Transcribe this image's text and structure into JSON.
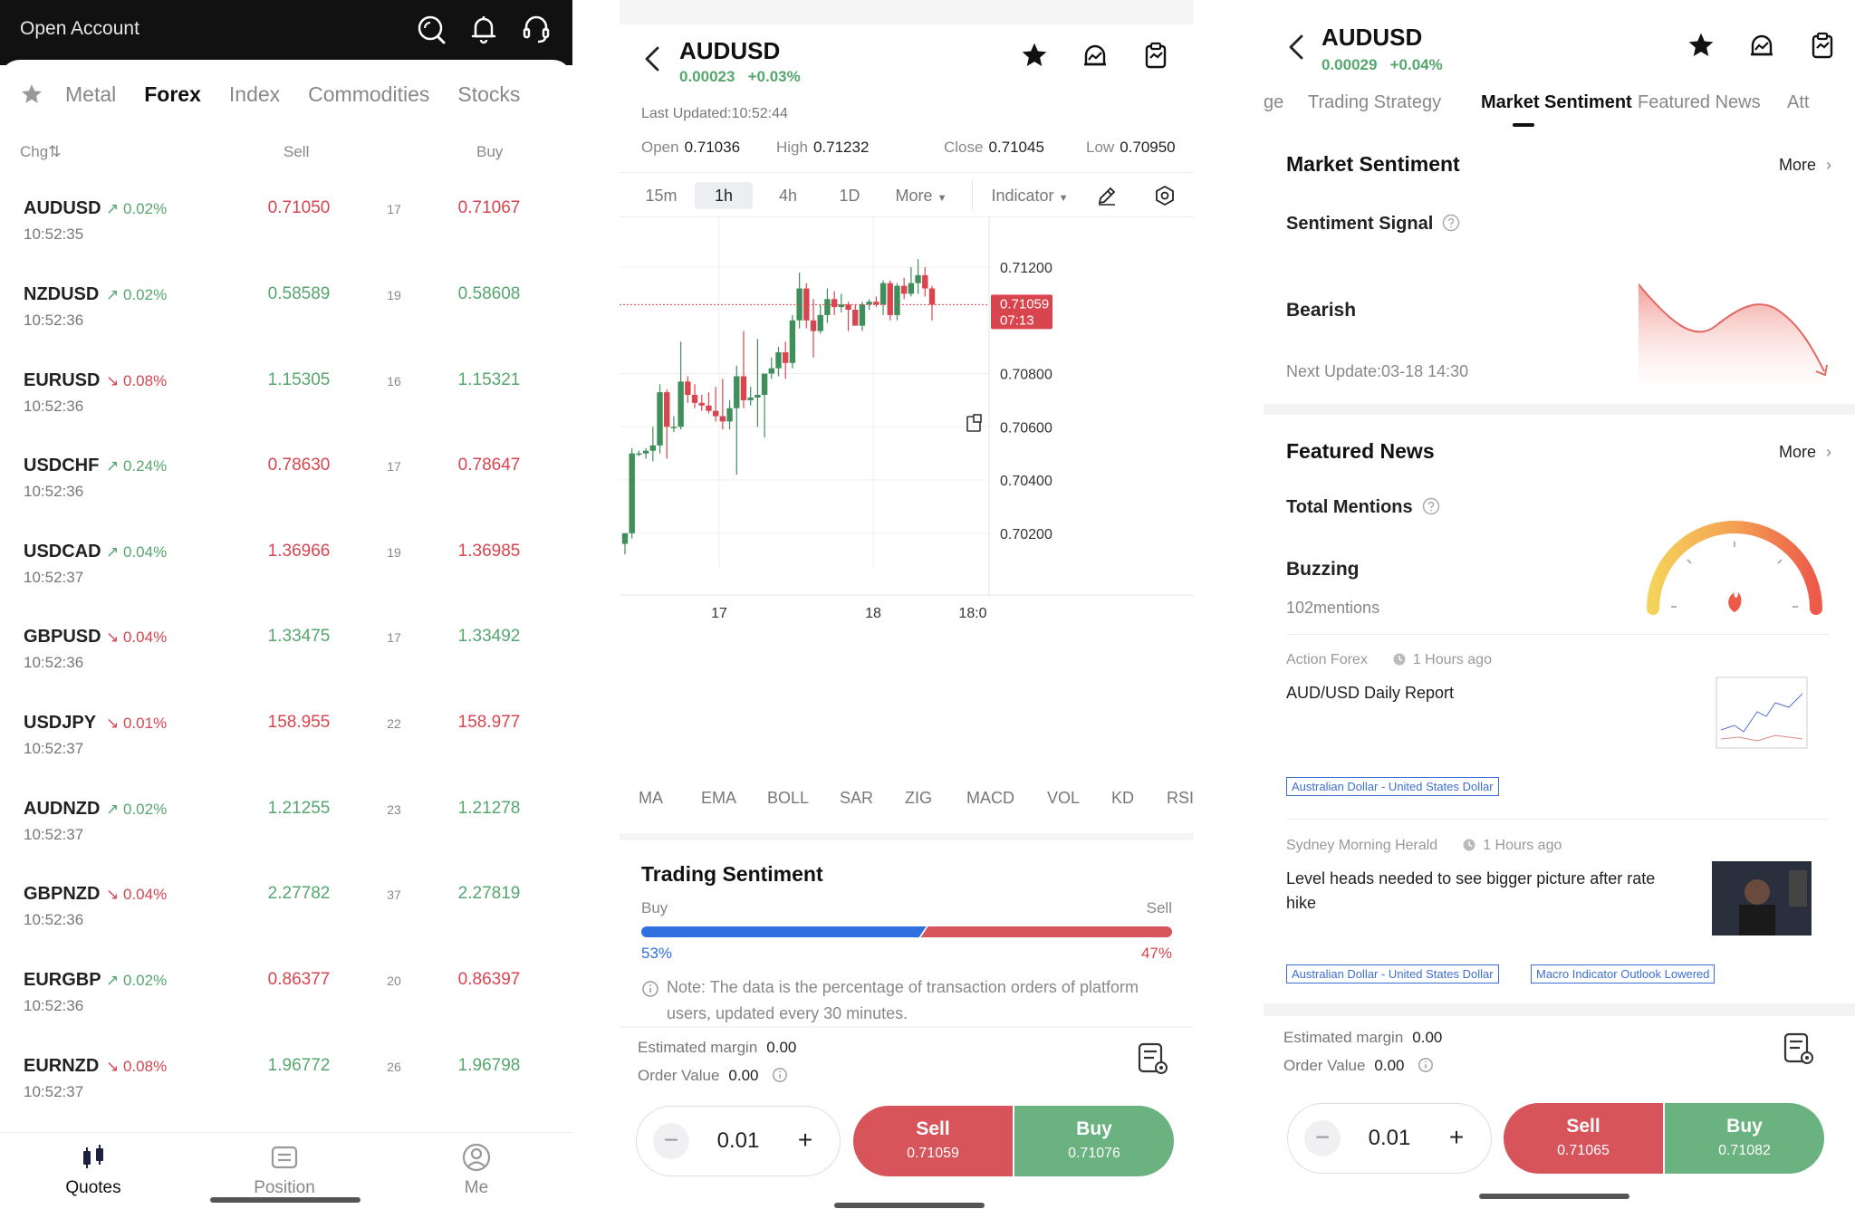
{
  "quotes_screen": {
    "title": "Open Account",
    "tabs": [
      "Metal",
      "Forex",
      "Index",
      "Commodities",
      "Stocks"
    ],
    "active_tab": "Forex",
    "columns": {
      "chg": "Chg⇅",
      "sell": "Sell",
      "buy": "Buy"
    },
    "rows": [
      {
        "symbol": "AUDUSD",
        "dir": "up",
        "chg": "0.02%",
        "time": "10:52:35",
        "sell": "0.71050",
        "spread": "17",
        "buy": "0.71067",
        "color": "red"
      },
      {
        "symbol": "NZDUSD",
        "dir": "up",
        "chg": "0.02%",
        "time": "10:52:36",
        "sell": "0.58589",
        "spread": "19",
        "buy": "0.58608",
        "color": "green"
      },
      {
        "symbol": "EURUSD",
        "dir": "down",
        "chg": "0.08%",
        "time": "10:52:36",
        "sell": "1.15305",
        "spread": "16",
        "buy": "1.15321",
        "color": "green"
      },
      {
        "symbol": "USDCHF",
        "dir": "up",
        "chg": "0.24%",
        "time": "10:52:36",
        "sell": "0.78630",
        "spread": "17",
        "buy": "0.78647",
        "color": "red"
      },
      {
        "symbol": "USDCAD",
        "dir": "up",
        "chg": "0.04%",
        "time": "10:52:37",
        "sell": "1.36966",
        "spread": "19",
        "buy": "1.36985",
        "color": "red"
      },
      {
        "symbol": "GBPUSD",
        "dir": "down",
        "chg": "0.04%",
        "time": "10:52:36",
        "sell": "1.33475",
        "spread": "17",
        "buy": "1.33492",
        "color": "green"
      },
      {
        "symbol": "USDJPY",
        "dir": "down",
        "chg": "0.01%",
        "time": "10:52:37",
        "sell": "158.955",
        "spread": "22",
        "buy": "158.977",
        "color": "red"
      },
      {
        "symbol": "AUDNZD",
        "dir": "up",
        "chg": "0.02%",
        "time": "10:52:37",
        "sell": "1.21255",
        "spread": "23",
        "buy": "1.21278",
        "color": "green"
      },
      {
        "symbol": "GBPNZD",
        "dir": "down",
        "chg": "0.04%",
        "time": "10:52:36",
        "sell": "2.27782",
        "spread": "37",
        "buy": "2.27819",
        "color": "green"
      },
      {
        "symbol": "EURGBP",
        "dir": "up",
        "chg": "0.02%",
        "time": "10:52:36",
        "sell": "0.86377",
        "spread": "20",
        "buy": "0.86397",
        "color": "red"
      },
      {
        "symbol": "EURNZD",
        "dir": "down",
        "chg": "0.08%",
        "time": "10:52:37",
        "sell": "1.96772",
        "spread": "26",
        "buy": "1.96798",
        "color": "green"
      }
    ],
    "bottom_nav": [
      "Quotes",
      "Position",
      "Me"
    ]
  },
  "chart_screen": {
    "symbol": "AUDUSD",
    "change": "0.00023",
    "change_pct": "+0.03%",
    "last_updated": "Last Updated:10:52:44",
    "ohlc": {
      "open_label": "Open",
      "open": "0.71036",
      "high_label": "High",
      "high": "0.71232",
      "close_label": "Close",
      "close": "0.71045",
      "low_label": "Low",
      "low": "0.70950"
    },
    "timeframes": [
      "15m",
      "1h",
      "4h",
      "1D"
    ],
    "active_timeframe": "1h",
    "more_label": "More",
    "indicator_label": "Indicator",
    "indicators": [
      "MA",
      "EMA",
      "BOLL",
      "SAR",
      "ZIG",
      "MACD",
      "VOL",
      "KD",
      "RSI"
    ],
    "sentiment": {
      "title": "Trading Sentiment",
      "buy_label": "Buy",
      "sell_label": "Sell",
      "buy_pct": "53%",
      "sell_pct": "47%",
      "buy_fraction": 0.53,
      "note": "Note: The data is the percentage of transaction orders of platform users, updated every 30 minutes."
    },
    "order": {
      "margin_label": "Estimated margin",
      "margin": "0.00",
      "value_label": "Order Value",
      "value": "0.00",
      "lot": "0.01",
      "sell_label": "Sell",
      "sell_price": "0.71059",
      "buy_label": "Buy",
      "buy_price": "0.71076"
    }
  },
  "chart_data": {
    "type": "candlestick",
    "x_ticks": [
      "17",
      "18",
      "18:0"
    ],
    "y_ticks": [
      "0.71200",
      "0.70800",
      "0.70600",
      "0.70400",
      "0.70200"
    ],
    "ylim": [
      0.7007,
      0.7136
    ],
    "current_price": "0.71059",
    "current_countdown": "07:13",
    "current_value": 0.71059,
    "candles": [
      {
        "o": 0.7016,
        "h": 0.702,
        "l": 0.7012,
        "c": 0.702
      },
      {
        "o": 0.702,
        "h": 0.7052,
        "l": 0.7018,
        "c": 0.705
      },
      {
        "o": 0.705,
        "h": 0.7051,
        "l": 0.7049,
        "c": 0.705
      },
      {
        "o": 0.705,
        "h": 0.7052,
        "l": 0.7048,
        "c": 0.7051
      },
      {
        "o": 0.7051,
        "h": 0.706,
        "l": 0.7047,
        "c": 0.7053
      },
      {
        "o": 0.7053,
        "h": 0.7076,
        "l": 0.705,
        "c": 0.7073
      },
      {
        "o": 0.7073,
        "h": 0.7074,
        "l": 0.7048,
        "c": 0.706
      },
      {
        "o": 0.706,
        "h": 0.7064,
        "l": 0.7058,
        "c": 0.706
      },
      {
        "o": 0.706,
        "h": 0.7092,
        "l": 0.7059,
        "c": 0.7077
      },
      {
        "o": 0.7077,
        "h": 0.7079,
        "l": 0.7069,
        "c": 0.7072
      },
      {
        "o": 0.7072,
        "h": 0.7076,
        "l": 0.7067,
        "c": 0.7069
      },
      {
        "o": 0.7069,
        "h": 0.7072,
        "l": 0.7066,
        "c": 0.7068
      },
      {
        "o": 0.7068,
        "h": 0.7073,
        "l": 0.7065,
        "c": 0.7066
      },
      {
        "o": 0.7066,
        "h": 0.7075,
        "l": 0.7062,
        "c": 0.7064
      },
      {
        "o": 0.7064,
        "h": 0.7078,
        "l": 0.7059,
        "c": 0.7062
      },
      {
        "o": 0.7062,
        "h": 0.707,
        "l": 0.7059,
        "c": 0.7067
      },
      {
        "o": 0.7067,
        "h": 0.7083,
        "l": 0.7042,
        "c": 0.7079
      },
      {
        "o": 0.7079,
        "h": 0.7096,
        "l": 0.7067,
        "c": 0.707
      },
      {
        "o": 0.707,
        "h": 0.7075,
        "l": 0.7068,
        "c": 0.7071
      },
      {
        "o": 0.7071,
        "h": 0.7093,
        "l": 0.706,
        "c": 0.7072
      },
      {
        "o": 0.7072,
        "h": 0.708,
        "l": 0.7056,
        "c": 0.708
      },
      {
        "o": 0.708,
        "h": 0.7086,
        "l": 0.7078,
        "c": 0.7082
      },
      {
        "o": 0.7082,
        "h": 0.709,
        "l": 0.7079,
        "c": 0.7088
      },
      {
        "o": 0.7088,
        "h": 0.7092,
        "l": 0.7078,
        "c": 0.7084
      },
      {
        "o": 0.7084,
        "h": 0.7102,
        "l": 0.7082,
        "c": 0.71
      },
      {
        "o": 0.71,
        "h": 0.7118,
        "l": 0.7097,
        "c": 0.7112
      },
      {
        "o": 0.7112,
        "h": 0.7114,
        "l": 0.7097,
        "c": 0.71
      },
      {
        "o": 0.71,
        "h": 0.7108,
        "l": 0.7086,
        "c": 0.7096
      },
      {
        "o": 0.7096,
        "h": 0.7106,
        "l": 0.7095,
        "c": 0.7102
      },
      {
        "o": 0.7102,
        "h": 0.7112,
        "l": 0.7099,
        "c": 0.7108
      },
      {
        "o": 0.7108,
        "h": 0.7111,
        "l": 0.7102,
        "c": 0.7105
      },
      {
        "o": 0.7105,
        "h": 0.711,
        "l": 0.7103,
        "c": 0.7106
      },
      {
        "o": 0.7106,
        "h": 0.7107,
        "l": 0.7096,
        "c": 0.7104
      },
      {
        "o": 0.7104,
        "h": 0.7106,
        "l": 0.7099,
        "c": 0.7098
      },
      {
        "o": 0.7098,
        "h": 0.7107,
        "l": 0.7096,
        "c": 0.7106
      },
      {
        "o": 0.7106,
        "h": 0.7108,
        "l": 0.7104,
        "c": 0.7107
      },
      {
        "o": 0.7107,
        "h": 0.7109,
        "l": 0.7105,
        "c": 0.7106
      },
      {
        "o": 0.7106,
        "h": 0.7115,
        "l": 0.7102,
        "c": 0.7114
      },
      {
        "o": 0.7114,
        "h": 0.7115,
        "l": 0.71,
        "c": 0.7102
      },
      {
        "o": 0.7102,
        "h": 0.7114,
        "l": 0.71,
        "c": 0.7113
      },
      {
        "o": 0.7113,
        "h": 0.7116,
        "l": 0.7108,
        "c": 0.711
      },
      {
        "o": 0.711,
        "h": 0.712,
        "l": 0.7109,
        "c": 0.7114
      },
      {
        "o": 0.7114,
        "h": 0.7123,
        "l": 0.711,
        "c": 0.7117
      },
      {
        "o": 0.7117,
        "h": 0.712,
        "l": 0.7109,
        "c": 0.7112
      },
      {
        "o": 0.7112,
        "h": 0.7113,
        "l": 0.71,
        "c": 0.71059
      }
    ],
    "up_color": "#3f8f5a",
    "down_color": "#d8454f"
  },
  "sentiment_screen": {
    "symbol": "AUDUSD",
    "change": "0.00029",
    "change_pct": "+0.04%",
    "tabs": [
      "ge",
      "Trading Strategy",
      "Market Sentiment",
      "Featured News",
      "Att"
    ],
    "active_tab": "Market Sentiment",
    "market_sentiment": {
      "title": "Market Sentiment",
      "more": "More",
      "signal_label": "Sentiment Signal",
      "signal": "Bearish",
      "next_update": "Next Update:03-18 14:30"
    },
    "featured_news": {
      "title": "Featured News",
      "more": "More",
      "mentions_label": "Total Mentions",
      "level": "Buzzing",
      "mentions": "102mentions",
      "articles": [
        {
          "source": "Action Forex",
          "ago": "1 Hours ago",
          "headline": "AUD/USD Daily Report",
          "tags": [
            "Australian Dollar - United States Dollar"
          ]
        },
        {
          "source": "Sydney Morning Herald",
          "ago": "1 Hours ago",
          "headline": "Level heads needed to see bigger picture after rate hike",
          "tags": [
            "Australian Dollar - United States Dollar",
            "Macro Indicator Outlook Lowered"
          ]
        }
      ]
    },
    "order": {
      "margin_label": "Estimated margin",
      "margin": "0.00",
      "value_label": "Order Value",
      "value": "0.00",
      "lot": "0.01",
      "sell_label": "Sell",
      "sell_price": "0.71065",
      "buy_label": "Buy",
      "buy_price": "0.71082"
    }
  },
  "colors": {
    "up": "#55a76e",
    "down": "#d8454f",
    "accent_blue": "#2f6fe0"
  }
}
